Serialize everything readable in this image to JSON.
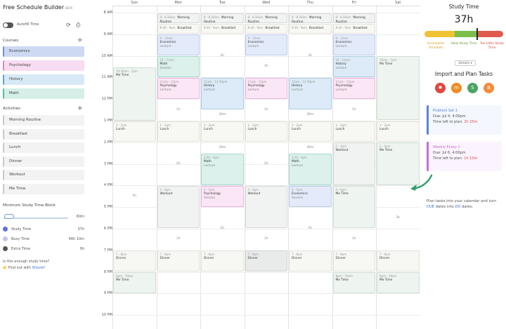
{
  "app": {
    "title": "Free Schedule Builder",
    "beta": "BETA"
  },
  "toolbar": {
    "toggle_label": "Autofill Time",
    "refresh_icon": "refresh-icon",
    "print_icon": "print-icon"
  },
  "courses": {
    "heading": "Courses",
    "items": [
      {
        "label": "Economics",
        "color": "#cdd9f2",
        "accent": "#6f8fd8"
      },
      {
        "label": "Psychology",
        "color": "#f8dcf1",
        "accent": "#e084cc"
      },
      {
        "label": "History",
        "color": "#d7e9f5",
        "accent": "#5fa3d2"
      },
      {
        "label": "Math",
        "color": "#d5efe8",
        "accent": "#4fbf9e"
      }
    ]
  },
  "activities": {
    "heading": "Activities",
    "items": [
      {
        "label": "Morning Routine"
      },
      {
        "label": "Breakfast"
      },
      {
        "label": "Lunch"
      },
      {
        "label": "Dinner"
      },
      {
        "label": "Workout"
      },
      {
        "label": "Me Time"
      }
    ]
  },
  "min_block": {
    "label": "Minimum Study Time Block",
    "value": "60m",
    "fraction": 0.15
  },
  "legend": [
    {
      "label": "Study Time",
      "value": "37h",
      "color": "#5b6ee0"
    },
    {
      "label": "Busy Time",
      "value": "46h 10m",
      "color": "#bfc7e8"
    },
    {
      "label": "Extra Time",
      "value": "0h",
      "color": "#555555"
    }
  ],
  "enough": {
    "question": "Is this enough study time?",
    "prefix": "Find out with",
    "link": "Shovel!"
  },
  "calendar": {
    "days": [
      "Sun",
      "Mon",
      "Tue",
      "Wed",
      "Thu",
      "Fri",
      "Sat"
    ],
    "hours": [
      "8 AM",
      "9 AM",
      "10 AM",
      "11 AM",
      "12 PM",
      "1 PM",
      "2 PM",
      "3 PM",
      "4 PM",
      "5 PM",
      "6 PM",
      "7 PM",
      "8 PM",
      "9 PM",
      "10 PM"
    ],
    "events": [
      {
        "day": 1,
        "start": 8.0,
        "end": 8.5,
        "time": "8 - 8:30am",
        "name": "Morning Routine",
        "kind": "act"
      },
      {
        "day": 2,
        "start": 8.0,
        "end": 8.5,
        "time": "8 - 8:30am",
        "name": "Morning Routine",
        "kind": "act"
      },
      {
        "day": 3,
        "start": 8.0,
        "end": 8.5,
        "time": "8 - 8:30am",
        "name": "Morning Routine",
        "kind": "act"
      },
      {
        "day": 4,
        "start": 8.0,
        "end": 8.5,
        "time": "8 - 8:30am",
        "name": "Morning Routine",
        "kind": "act"
      },
      {
        "day": 5,
        "start": 8.0,
        "end": 8.5,
        "time": "8 - 8:30am",
        "name": "Morning Routine",
        "kind": "act"
      },
      {
        "day": 1,
        "start": 8.5,
        "end": 9.0,
        "time": "8:30 - 9am",
        "name": "Breakfast",
        "kind": "meal"
      },
      {
        "day": 2,
        "start": 8.5,
        "end": 9.0,
        "time": "8:30 - 9am",
        "name": "Breakfast",
        "kind": "meal"
      },
      {
        "day": 3,
        "start": 8.5,
        "end": 9.0,
        "time": "8:30 - 9am",
        "name": "Breakfast",
        "kind": "meal"
      },
      {
        "day": 4,
        "start": 8.5,
        "end": 9.0,
        "time": "8:30 - 9am",
        "name": "Breakfast",
        "kind": "meal"
      },
      {
        "day": 5,
        "start": 8.5,
        "end": 9.0,
        "time": "8:30 - 9am",
        "name": "Breakfast",
        "kind": "meal"
      },
      {
        "day": 1,
        "start": 9.0,
        "end": 10.0,
        "time": "9 - 10am",
        "name": "Economics",
        "sub": "Lecture",
        "kind": "econ"
      },
      {
        "day": 3,
        "start": 9.0,
        "end": 10.0,
        "time": "9 - 10am",
        "name": "Economics",
        "sub": "Lecture",
        "kind": "econ"
      },
      {
        "day": 5,
        "start": 9.0,
        "end": 10.0,
        "time": "9 - 10am",
        "name": "Economics",
        "sub": "Lecture",
        "kind": "econ"
      },
      {
        "day": 1,
        "start": 10.0,
        "end": 11.0,
        "time": "10 - 11am",
        "name": "Math",
        "sub": "Session",
        "kind": "math"
      },
      {
        "day": 5,
        "start": 10.0,
        "end": 11.0,
        "time": "10 - 11am",
        "name": "History",
        "sub": "Lecture",
        "kind": "hist"
      },
      {
        "day": 1,
        "start": 11.0,
        "end": 12.0,
        "time": "11am - 12pm",
        "name": "Psychology",
        "sub": "Lecture",
        "kind": "psych"
      },
      {
        "day": 2,
        "start": 11.0,
        "end": 12.5,
        "time": "11am - 12:30pm",
        "name": "History",
        "sub": "Lecture",
        "kind": "hist"
      },
      {
        "day": 3,
        "start": 11.0,
        "end": 12.0,
        "time": "11am - 12pm",
        "name": "Psychology",
        "sub": "Lecture",
        "kind": "psych"
      },
      {
        "day": 4,
        "start": 11.0,
        "end": 12.5,
        "time": "11am - 12:30pm",
        "name": "History",
        "sub": "Lecture",
        "kind": "hist"
      },
      {
        "day": 5,
        "start": 11.0,
        "end": 12.0,
        "time": "11am - 12pm",
        "name": "Psychology",
        "sub": "Lecture",
        "kind": "psych"
      },
      {
        "day": 0,
        "start": 10.5,
        "end": 13.0,
        "time": "10:30am - 1pm",
        "name": "Me Time",
        "kind": "metime"
      },
      {
        "day": 6,
        "start": 10.0,
        "end": 13.0,
        "time": "10am - 1pm",
        "name": "Me Time",
        "kind": "metime"
      },
      {
        "day": 0,
        "start": 13.0,
        "end": 14.0,
        "time": "1 - 2pm",
        "name": "Lunch",
        "kind": "meal"
      },
      {
        "day": 1,
        "start": 13.0,
        "end": 14.0,
        "time": "1 - 2pm",
        "name": "Lunch",
        "kind": "meal"
      },
      {
        "day": 2,
        "start": 13.0,
        "end": 14.0,
        "time": "1 - 2pm",
        "name": "Lunch",
        "kind": "meal"
      },
      {
        "day": 3,
        "start": 13.0,
        "end": 14.0,
        "time": "1 - 2pm",
        "name": "Lunch",
        "kind": "meal"
      },
      {
        "day": 4,
        "start": 13.0,
        "end": 14.0,
        "time": "1 - 2pm",
        "name": "Lunch",
        "kind": "meal"
      },
      {
        "day": 5,
        "start": 13.0,
        "end": 14.0,
        "time": "1 - 2pm",
        "name": "Lunch",
        "kind": "meal"
      },
      {
        "day": 6,
        "start": 13.0,
        "end": 14.0,
        "time": "1 - 2pm",
        "name": "Lunch",
        "kind": "meal"
      },
      {
        "day": 2,
        "start": 14.5,
        "end": 16.0,
        "time": "2:30 - 4pm",
        "name": "Math",
        "sub": "Lecture",
        "kind": "math"
      },
      {
        "day": 4,
        "start": 14.5,
        "end": 16.0,
        "time": "2:30 - 4pm",
        "name": "Math",
        "sub": "Lecture",
        "kind": "math"
      },
      {
        "day": 5,
        "start": 14.0,
        "end": 16.0,
        "time": "2 - 4pm",
        "name": "Workout",
        "kind": "act"
      },
      {
        "day": 6,
        "start": 14.0,
        "end": 16.0,
        "time": "2 - 4pm",
        "name": "Me Time",
        "kind": "metime"
      },
      {
        "day": 1,
        "start": 16.0,
        "end": 18.0,
        "time": "4 - 6pm",
        "name": "Workout",
        "kind": "act"
      },
      {
        "day": 2,
        "start": 16.0,
        "end": 17.0,
        "time": "4 - 5pm",
        "name": "Psychology",
        "sub": "Session",
        "kind": "psych"
      },
      {
        "day": 3,
        "start": 16.0,
        "end": 18.0,
        "time": "4 - 6pm",
        "name": "Workout",
        "kind": "act"
      },
      {
        "day": 4,
        "start": 16.0,
        "end": 17.0,
        "time": "4 - 5pm",
        "name": "Economics",
        "sub": "Session",
        "kind": "econ"
      },
      {
        "day": 5,
        "start": 16.0,
        "end": 18.0,
        "time": "4 - 6pm",
        "name": "Me Time",
        "kind": "metime"
      },
      {
        "day": 0,
        "start": 19.0,
        "end": 20.0,
        "time": "7 - 8pm",
        "name": "Dinner",
        "kind": "meal"
      },
      {
        "day": 1,
        "start": 19.0,
        "end": 20.0,
        "time": "7 - 8pm",
        "name": "Dinner",
        "kind": "meal"
      },
      {
        "day": 2,
        "start": 19.0,
        "end": 20.0,
        "time": "7 - 8pm",
        "name": "Dinner",
        "kind": "meal"
      },
      {
        "day": 3,
        "start": 19.0,
        "end": 20.0,
        "time": "7 - 8pm",
        "name": "Dinner",
        "kind": "gray"
      },
      {
        "day": 4,
        "start": 19.0,
        "end": 20.0,
        "time": "7 - 8pm",
        "name": "Dinner",
        "kind": "meal"
      },
      {
        "day": 5,
        "start": 19.0,
        "end": 20.0,
        "time": "7 - 8pm",
        "name": "Dinner",
        "kind": "meal"
      },
      {
        "day": 6,
        "start": 19.0,
        "end": 20.0,
        "time": "7 - 8pm",
        "name": "Dinner",
        "kind": "meal"
      },
      {
        "day": 0,
        "start": 20.0,
        "end": 21.0,
        "time": "8pm - 10am",
        "name": "Me Time",
        "kind": "metime"
      },
      {
        "day": 5,
        "start": 20.0,
        "end": 21.0,
        "time": "8pm - 10am",
        "name": "Me Time",
        "kind": "metime"
      },
      {
        "day": 6,
        "start": 20.0,
        "end": 21.0,
        "time": "8pm - 10am",
        "name": "Me Time",
        "kind": "metime"
      }
    ],
    "free": [
      {
        "day": 0,
        "start": 14.0,
        "end": 19.0,
        "label": "5h"
      },
      {
        "day": 1,
        "start": 12.0,
        "end": 13.0,
        "label": "1h"
      },
      {
        "day": 1,
        "start": 14.0,
        "end": 16.0,
        "label": "2h"
      },
      {
        "day": 1,
        "start": 18.0,
        "end": 19.0,
        "label": "1h"
      },
      {
        "day": 2,
        "start": 9.0,
        "end": 11.0,
        "label": "2h"
      },
      {
        "day": 2,
        "start": 12.5,
        "end": 13.0,
        "label": "30m"
      },
      {
        "day": 2,
        "start": 14.0,
        "end": 14.5,
        "label": "30m"
      },
      {
        "day": 2,
        "start": 17.0,
        "end": 19.0,
        "label": "2h"
      },
      {
        "day": 3,
        "start": 10.0,
        "end": 11.0,
        "label": "1h"
      },
      {
        "day": 3,
        "start": 12.0,
        "end": 13.0,
        "label": "1h"
      },
      {
        "day": 3,
        "start": 14.0,
        "end": 16.0,
        "label": "2h"
      },
      {
        "day": 3,
        "start": 18.0,
        "end": 19.0,
        "label": "1h"
      },
      {
        "day": 4,
        "start": 9.0,
        "end": 11.0,
        "label": "2h"
      },
      {
        "day": 4,
        "start": 12.5,
        "end": 13.0,
        "label": "30m"
      },
      {
        "day": 4,
        "start": 14.0,
        "end": 14.5,
        "label": "30m"
      },
      {
        "day": 4,
        "start": 17.0,
        "end": 19.0,
        "label": "2h"
      },
      {
        "day": 5,
        "start": 12.0,
        "end": 13.0,
        "label": "1h"
      },
      {
        "day": 5,
        "start": 18.0,
        "end": 19.0,
        "label": "1h"
      },
      {
        "day": 6,
        "start": 16.0,
        "end": 19.0,
        "label": "3h"
      }
    ]
  },
  "study_time": {
    "title": "Study Time",
    "hours": "37h",
    "marker_fraction": 0.66,
    "segments": [
      {
        "color": "#f1c232",
        "fraction": 0.38
      },
      {
        "color": "#7bbf4a",
        "fraction": 0.28
      },
      {
        "color": "#e05a4e",
        "fraction": 0.34
      }
    ],
    "labels": [
      {
        "text": "Incomplete Schedule",
        "color": "#d3a21f"
      },
      {
        "text": "Ideal Study Time",
        "color": "#5f9b35"
      },
      {
        "text": "Too Little Study Time",
        "color": "#d4493e"
      }
    ],
    "details": "Details ▾"
  },
  "import_plan": {
    "title": "Import and Plan Tasks",
    "icons": [
      {
        "name": "canvas-icon",
        "color": "#e1453d",
        "glyph": "✺"
      },
      {
        "name": "moodle-icon",
        "color": "#f08a24",
        "glyph": "m"
      },
      {
        "name": "schoology-icon",
        "color": "#4aa564",
        "glyph": "S"
      },
      {
        "name": "brightspace-icon",
        "color": "#f58a3d",
        "glyph": "B"
      }
    ]
  },
  "tasks": [
    {
      "name": "Problem Set 1",
      "due": "Due: Jul 4, 4:09pm",
      "left_prefix": "Time left to plan:",
      "left": "2h 25m",
      "color": "#5b83d8",
      "bg": "#f4f7fd"
    },
    {
      "name": "Weekly Essay 2",
      "due": "Due: Jul 6, 4:09pm",
      "left_prefix": "Time left to plan:",
      "left": "1h 10m",
      "color": "#c56ed8",
      "bg": "#fbf3fd"
    }
  ],
  "hint": {
    "text1": "Plan tasks into your calendar and turn",
    "due_word": "DUE",
    "text2": "dates into",
    "do_word": "DO",
    "text3": "dates."
  }
}
